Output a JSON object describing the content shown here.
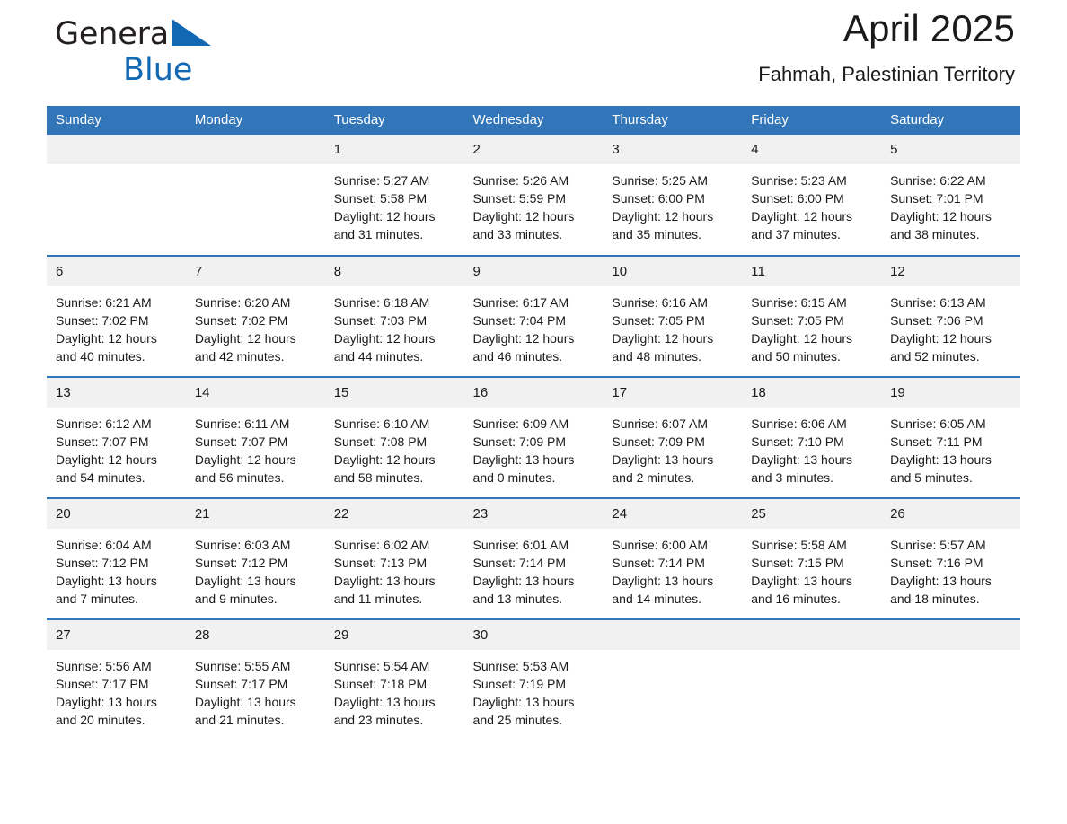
{
  "brand": {
    "name_part1": "General",
    "name_part2": "Blue",
    "triangle_icon": "triangle-icon",
    "accent_color": "#1268b3"
  },
  "header": {
    "title": "April 2025",
    "subtitle": "Fahmah, Palestinian Territory"
  },
  "theme": {
    "header_blue": "#3275b8",
    "daynum_gray": "#f1f1f1",
    "text": "#1a1a1a"
  },
  "weekdays": [
    "Sunday",
    "Monday",
    "Tuesday",
    "Wednesday",
    "Thursday",
    "Friday",
    "Saturday"
  ],
  "weeks": [
    [
      {
        "day": "",
        "sunrise": "",
        "sunset": "",
        "daylight1": "",
        "daylight2": "",
        "empty": true
      },
      {
        "day": "",
        "sunrise": "",
        "sunset": "",
        "daylight1": "",
        "daylight2": "",
        "empty": true
      },
      {
        "day": "1",
        "sunrise": "Sunrise: 5:27 AM",
        "sunset": "Sunset: 5:58 PM",
        "daylight1": "Daylight: 12 hours",
        "daylight2": "and 31 minutes."
      },
      {
        "day": "2",
        "sunrise": "Sunrise: 5:26 AM",
        "sunset": "Sunset: 5:59 PM",
        "daylight1": "Daylight: 12 hours",
        "daylight2": "and 33 minutes."
      },
      {
        "day": "3",
        "sunrise": "Sunrise: 5:25 AM",
        "sunset": "Sunset: 6:00 PM",
        "daylight1": "Daylight: 12 hours",
        "daylight2": "and 35 minutes."
      },
      {
        "day": "4",
        "sunrise": "Sunrise: 5:23 AM",
        "sunset": "Sunset: 6:00 PM",
        "daylight1": "Daylight: 12 hours",
        "daylight2": "and 37 minutes."
      },
      {
        "day": "5",
        "sunrise": "Sunrise: 6:22 AM",
        "sunset": "Sunset: 7:01 PM",
        "daylight1": "Daylight: 12 hours",
        "daylight2": "and 38 minutes."
      }
    ],
    [
      {
        "day": "6",
        "sunrise": "Sunrise: 6:21 AM",
        "sunset": "Sunset: 7:02 PM",
        "daylight1": "Daylight: 12 hours",
        "daylight2": "and 40 minutes."
      },
      {
        "day": "7",
        "sunrise": "Sunrise: 6:20 AM",
        "sunset": "Sunset: 7:02 PM",
        "daylight1": "Daylight: 12 hours",
        "daylight2": "and 42 minutes."
      },
      {
        "day": "8",
        "sunrise": "Sunrise: 6:18 AM",
        "sunset": "Sunset: 7:03 PM",
        "daylight1": "Daylight: 12 hours",
        "daylight2": "and 44 minutes."
      },
      {
        "day": "9",
        "sunrise": "Sunrise: 6:17 AM",
        "sunset": "Sunset: 7:04 PM",
        "daylight1": "Daylight: 12 hours",
        "daylight2": "and 46 minutes."
      },
      {
        "day": "10",
        "sunrise": "Sunrise: 6:16 AM",
        "sunset": "Sunset: 7:05 PM",
        "daylight1": "Daylight: 12 hours",
        "daylight2": "and 48 minutes."
      },
      {
        "day": "11",
        "sunrise": "Sunrise: 6:15 AM",
        "sunset": "Sunset: 7:05 PM",
        "daylight1": "Daylight: 12 hours",
        "daylight2": "and 50 minutes."
      },
      {
        "day": "12",
        "sunrise": "Sunrise: 6:13 AM",
        "sunset": "Sunset: 7:06 PM",
        "daylight1": "Daylight: 12 hours",
        "daylight2": "and 52 minutes."
      }
    ],
    [
      {
        "day": "13",
        "sunrise": "Sunrise: 6:12 AM",
        "sunset": "Sunset: 7:07 PM",
        "daylight1": "Daylight: 12 hours",
        "daylight2": "and 54 minutes."
      },
      {
        "day": "14",
        "sunrise": "Sunrise: 6:11 AM",
        "sunset": "Sunset: 7:07 PM",
        "daylight1": "Daylight: 12 hours",
        "daylight2": "and 56 minutes."
      },
      {
        "day": "15",
        "sunrise": "Sunrise: 6:10 AM",
        "sunset": "Sunset: 7:08 PM",
        "daylight1": "Daylight: 12 hours",
        "daylight2": "and 58 minutes."
      },
      {
        "day": "16",
        "sunrise": "Sunrise: 6:09 AM",
        "sunset": "Sunset: 7:09 PM",
        "daylight1": "Daylight: 13 hours",
        "daylight2": "and 0 minutes."
      },
      {
        "day": "17",
        "sunrise": "Sunrise: 6:07 AM",
        "sunset": "Sunset: 7:09 PM",
        "daylight1": "Daylight: 13 hours",
        "daylight2": "and 2 minutes."
      },
      {
        "day": "18",
        "sunrise": "Sunrise: 6:06 AM",
        "sunset": "Sunset: 7:10 PM",
        "daylight1": "Daylight: 13 hours",
        "daylight2": "and 3 minutes."
      },
      {
        "day": "19",
        "sunrise": "Sunrise: 6:05 AM",
        "sunset": "Sunset: 7:11 PM",
        "daylight1": "Daylight: 13 hours",
        "daylight2": "and 5 minutes."
      }
    ],
    [
      {
        "day": "20",
        "sunrise": "Sunrise: 6:04 AM",
        "sunset": "Sunset: 7:12 PM",
        "daylight1": "Daylight: 13 hours",
        "daylight2": "and 7 minutes."
      },
      {
        "day": "21",
        "sunrise": "Sunrise: 6:03 AM",
        "sunset": "Sunset: 7:12 PM",
        "daylight1": "Daylight: 13 hours",
        "daylight2": "and 9 minutes."
      },
      {
        "day": "22",
        "sunrise": "Sunrise: 6:02 AM",
        "sunset": "Sunset: 7:13 PM",
        "daylight1": "Daylight: 13 hours",
        "daylight2": "and 11 minutes."
      },
      {
        "day": "23",
        "sunrise": "Sunrise: 6:01 AM",
        "sunset": "Sunset: 7:14 PM",
        "daylight1": "Daylight: 13 hours",
        "daylight2": "and 13 minutes."
      },
      {
        "day": "24",
        "sunrise": "Sunrise: 6:00 AM",
        "sunset": "Sunset: 7:14 PM",
        "daylight1": "Daylight: 13 hours",
        "daylight2": "and 14 minutes."
      },
      {
        "day": "25",
        "sunrise": "Sunrise: 5:58 AM",
        "sunset": "Sunset: 7:15 PM",
        "daylight1": "Daylight: 13 hours",
        "daylight2": "and 16 minutes."
      },
      {
        "day": "26",
        "sunrise": "Sunrise: 5:57 AM",
        "sunset": "Sunset: 7:16 PM",
        "daylight1": "Daylight: 13 hours",
        "daylight2": "and 18 minutes."
      }
    ],
    [
      {
        "day": "27",
        "sunrise": "Sunrise: 5:56 AM",
        "sunset": "Sunset: 7:17 PM",
        "daylight1": "Daylight: 13 hours",
        "daylight2": "and 20 minutes."
      },
      {
        "day": "28",
        "sunrise": "Sunrise: 5:55 AM",
        "sunset": "Sunset: 7:17 PM",
        "daylight1": "Daylight: 13 hours",
        "daylight2": "and 21 minutes."
      },
      {
        "day": "29",
        "sunrise": "Sunrise: 5:54 AM",
        "sunset": "Sunset: 7:18 PM",
        "daylight1": "Daylight: 13 hours",
        "daylight2": "and 23 minutes."
      },
      {
        "day": "30",
        "sunrise": "Sunrise: 5:53 AM",
        "sunset": "Sunset: 7:19 PM",
        "daylight1": "Daylight: 13 hours",
        "daylight2": "and 25 minutes."
      },
      {
        "day": "",
        "sunrise": "",
        "sunset": "",
        "daylight1": "",
        "daylight2": "",
        "empty": true
      },
      {
        "day": "",
        "sunrise": "",
        "sunset": "",
        "daylight1": "",
        "daylight2": "",
        "empty": true
      },
      {
        "day": "",
        "sunrise": "",
        "sunset": "",
        "daylight1": "",
        "daylight2": "",
        "empty": true
      }
    ]
  ]
}
